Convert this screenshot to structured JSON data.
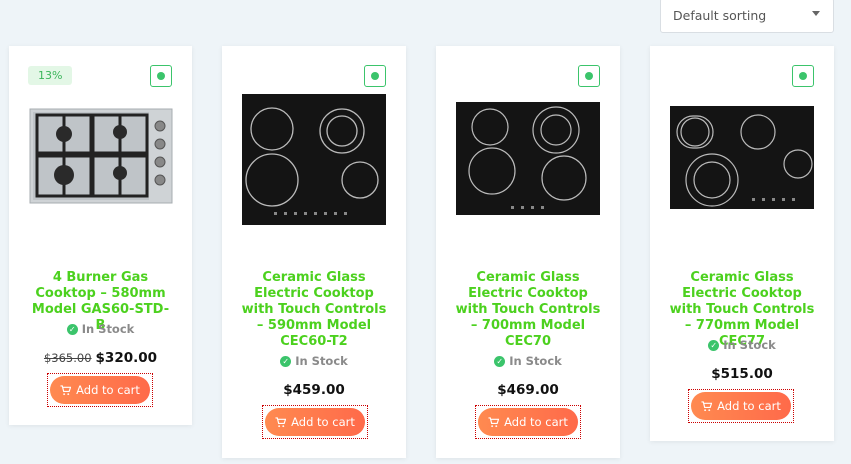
{
  "sorting": {
    "label": "Default sorting"
  },
  "products": [
    {
      "sale_badge": "13%",
      "title": "4 Burner Gas Cooktop – 580mm Model GAS60-STD-B",
      "stock": "In Stock",
      "old_price": "$365.00",
      "price": "$320.00",
      "cart_label": "Add to cart",
      "image": "gas-cooktop-4-burner"
    },
    {
      "title": "Ceramic Glass Electric Cooktop with Touch Controls – 590mm Model CEC60-T2",
      "stock": "In Stock",
      "price": "$459.00",
      "cart_label": "Add to cart",
      "image": "ceramic-cooktop-4-zone"
    },
    {
      "title": "Ceramic Glass Electric Cooktop with Touch Controls – 700mm Model CEC70",
      "stock": "In Stock",
      "price": "$469.00",
      "cart_label": "Add to cart",
      "image": "ceramic-cooktop-5-zone"
    },
    {
      "title": "Ceramic Glass Electric Cooktop with Touch Controls – 770mm Model CEC77",
      "stock": "In Stock",
      "price": "$515.00",
      "cart_label": "Add to cart",
      "image": "ceramic-cooktop-5-zone-wide"
    }
  ],
  "colors": {
    "title_green": "#4cd11e",
    "stock_check": "#3bc46b",
    "cart_gradient_start": "#ff8a50",
    "cart_gradient_end": "#ff6a4a"
  }
}
